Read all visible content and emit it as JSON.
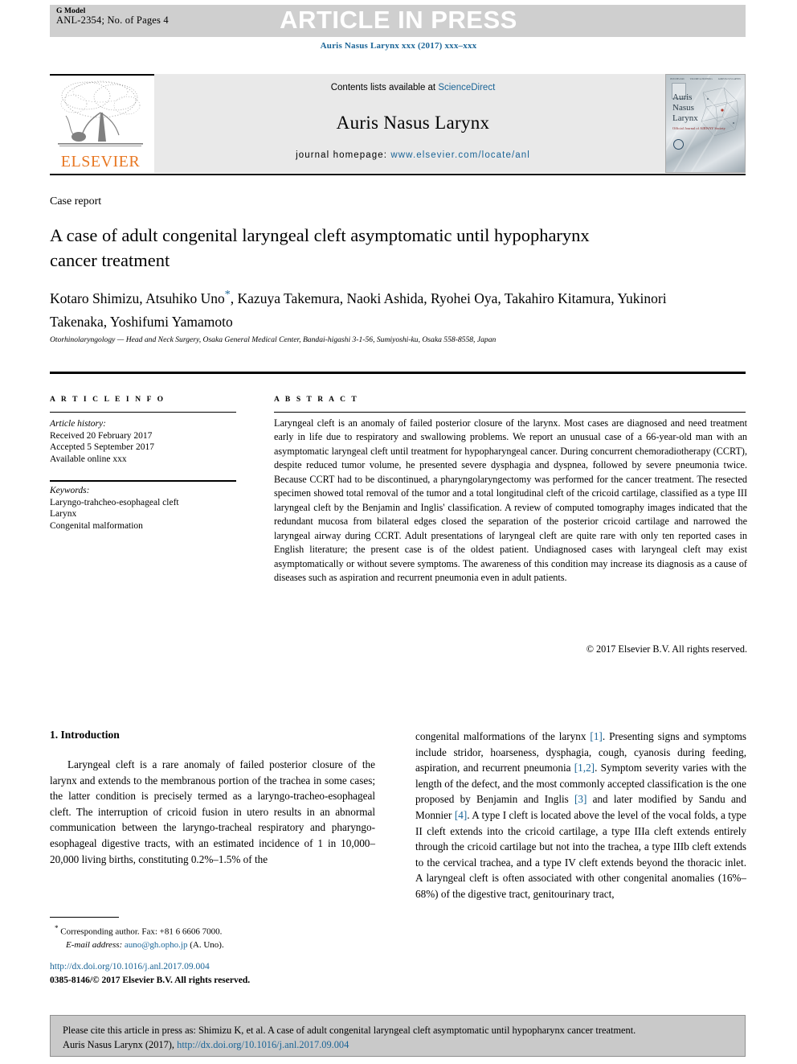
{
  "banner": {
    "gmodel_label": "G Model",
    "article_id": "ANL-2354; No. of Pages 4",
    "in_press": "ARTICLE IN PRESS"
  },
  "journal_citation": "Auris Nasus Larynx xxx (2017) xxx–xxx",
  "masthead": {
    "contents_prefix": "Contents lists available at ",
    "sciencedirect": "ScienceDirect",
    "journal_title": "Auris Nasus Larynx",
    "homepage_prefix": "journal homepage: ",
    "homepage_url": "www.elsevier.com/locate/anl",
    "publisher": "ELSEVIER",
    "cover_title_l1": "Auris",
    "cover_title_l2": "Nasus",
    "cover_title_l3": "Larynx",
    "cover_subtitle": "Official Journal of\nAIRWAY Society",
    "cover_top_left": "ISSN 0385-8146",
    "cover_top_mid": "VOLUME xx  NUMBER x",
    "cover_top_right": "AURIS NASUS LARYNX"
  },
  "article": {
    "type_label": "Case report",
    "title": "A case of adult congenital laryngeal cleft asymptomatic until hypopharynx cancer treatment",
    "authors": "Kotaro Shimizu, Atsuhiko Uno",
    "authors_rest": ", Kazuya Takemura, Naoki Ashida, Ryohei Oya, Takahiro Kitamura, Yukinori Takenaka, Yoshifumi Yamamoto",
    "affiliation": "Otorhinolaryngology — Head and Neck Surgery, Osaka General Medical Center, Bandai-higashi 3-1-56, Sumiyoshi-ku, Osaka 558-8558, Japan"
  },
  "info": {
    "header": "A R T I C L E   I N F O",
    "history_label": "Article history:",
    "received": "Received 20 February 2017",
    "accepted": "Accepted 5 September 2017",
    "available": "Available online xxx",
    "keywords_label": "Keywords:",
    "keywords": [
      "Laryngo-trahcheo-esophageal cleft",
      "Larynx",
      "Congenital malformation"
    ]
  },
  "abstract": {
    "header": "A B S T R A C T",
    "text": "Laryngeal cleft is an anomaly of failed posterior closure of the larynx. Most cases are diagnosed and need treatment early in life due to respiratory and swallowing problems. We report an unusual case of a 66-year-old man with an asymptomatic laryngeal cleft until treatment for hypopharyngeal cancer. During concurrent chemoradiotherapy (CCRT), despite reduced tumor volume, he presented severe dysphagia and dyspnea, followed by severe pneumonia twice. Because CCRT had to be discontinued, a pharyngolaryngectomy was performed for the cancer treatment. The resected specimen showed total removal of the tumor and a total longitudinal cleft of the cricoid cartilage, classified as a type III laryngeal cleft by the Benjamin and Inglis' classification. A review of computed tomography images indicated that the redundant mucosa from bilateral edges closed the separation of the posterior cricoid cartilage and narrowed the laryngeal airway during CCRT. Adult presentations of laryngeal cleft are quite rare with only ten reported cases in English literature; the present case is of the oldest patient. Undiagnosed cases with laryngeal cleft may exist asymptomatically or without severe symptoms. The awareness of this condition may increase its diagnosis as a cause of diseases such as aspiration and recurrent pneumonia even in adult patients.",
    "copyright": "© 2017 Elsevier B.V. All rights reserved."
  },
  "body": {
    "section_heading": "1. Introduction",
    "left_paragraph": "Laryngeal cleft is a rare anomaly of failed posterior closure of the larynx and extends to the membranous portion of the trachea in some cases; the latter condition is precisely termed as a laryngo-tracheo-esophageal cleft. The interruption of cricoid fusion in utero results in an abnormal communication between the laryngo-tracheal respiratory and pharyngo-esophageal digestive tracts, with an estimated incidence of 1 in 10,000–20,000 living births, constituting 0.2%–1.5% of the",
    "right_segments": [
      {
        "t": "congenital malformations of the larynx ",
        "ref": false
      },
      {
        "t": "[1]",
        "ref": true
      },
      {
        "t": ". Presenting signs and symptoms include stridor, hoarseness, dysphagia, cough, cyanosis during feeding, aspiration, and recurrent pneumonia ",
        "ref": false
      },
      {
        "t": "[1,2]",
        "ref": true
      },
      {
        "t": ". Symptom severity varies with the length of the defect, and the most commonly accepted classification is the one proposed by Benjamin and Inglis ",
        "ref": false
      },
      {
        "t": "[3]",
        "ref": true
      },
      {
        "t": " and later modified by Sandu and Monnier ",
        "ref": false
      },
      {
        "t": "[4]",
        "ref": true
      },
      {
        "t": ". A type I cleft is located above the level of the vocal folds, a type II cleft extends into the cricoid cartilage, a type IIIa cleft extends entirely through the cricoid cartilage but not into the trachea, a type IIIb cleft extends to the cervical trachea, and a type IV cleft extends beyond the thoracic inlet. A laryngeal cleft is often associated with other congenital anomalies (16%–68%) of the digestive tract, genitourinary tract,",
        "ref": false
      }
    ]
  },
  "footnotes": {
    "corresponding": "Corresponding author. Fax: +81 6 6606 7000.",
    "email_label": "E-mail address:",
    "email": "auno@gh.opho.jp",
    "email_suffix": " (A. Uno).",
    "doi": "http://dx.doi.org/10.1016/j.anl.2017.09.004",
    "issn": "0385-8146/© 2017 Elsevier B.V. All rights reserved."
  },
  "cite_box": {
    "line1": "Please cite this article in press as: Shimizu K, et al. A case of adult congenital laryngeal cleft asymptomatic until hypopharynx cancer treatment.",
    "line2_prefix": "Auris Nasus Larynx (2017), ",
    "line2_doi": "http://dx.doi.org/10.1016/j.anl.2017.09.004"
  },
  "colors": {
    "link": "#1a6496",
    "banner_bg": "#cfcfcf",
    "masthead_bg": "#e9e9e9",
    "elsevier_orange": "#E87722",
    "cite_bg": "#c9c9c9"
  }
}
